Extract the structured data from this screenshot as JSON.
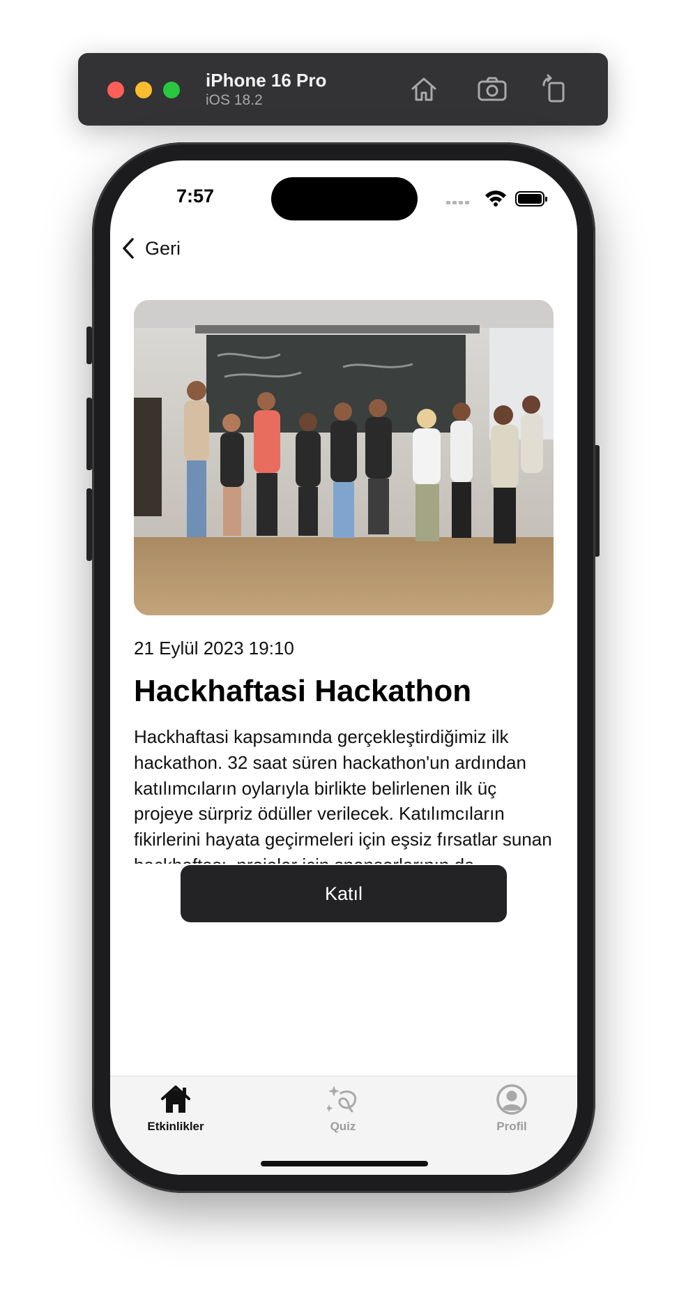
{
  "simulator": {
    "device": "iPhone 16 Pro",
    "os": "iOS 18.2",
    "icons": [
      "home-icon",
      "screenshot-icon",
      "rotate-icon"
    ]
  },
  "status_bar": {
    "time": "7:57",
    "icons": [
      "signal-icon",
      "wifi-icon",
      "battery-icon"
    ]
  },
  "nav": {
    "back_label": "Geri"
  },
  "event": {
    "date": "21 Eylül 2023 19:10",
    "title": "Hackhaftasi Hackathon",
    "description": "Hackhaftasi kapsamında gerçekleştirdiğimiz ilk hackathon. 32 saat süren hackathon'un ardından katılımcıların oylarıyla birlikte belirlenen ilk üç projeye sürpriz ödüller verilecek. Katılımcıların fikirlerini hayata geçirmeleri için eşsiz fırsatlar sunan hackhaftası, projeler için sponsorlarının da yardımlarıyla projelere gerekirse sunucu desteği ve openAI key desteği verebiliriz. Ayrıca katılımcıların istediği farklı bir destek olursa bunun için de yardımcı olabiliriz. Bu şekilde",
    "join_label": "Katıl"
  },
  "tabs": [
    {
      "label": "Etkinlikler",
      "icon": "house-icon",
      "active": true
    },
    {
      "label": "Quiz",
      "icon": "sparkle-loop-icon",
      "active": false
    },
    {
      "label": "Profil",
      "icon": "person-circle-icon",
      "active": false
    }
  ],
  "colors": {
    "button_bg": "#232325",
    "toolbar_bg": "#333335",
    "traffic_red": "#fe5f57",
    "traffic_yellow": "#febc2e",
    "traffic_green": "#28c840"
  }
}
